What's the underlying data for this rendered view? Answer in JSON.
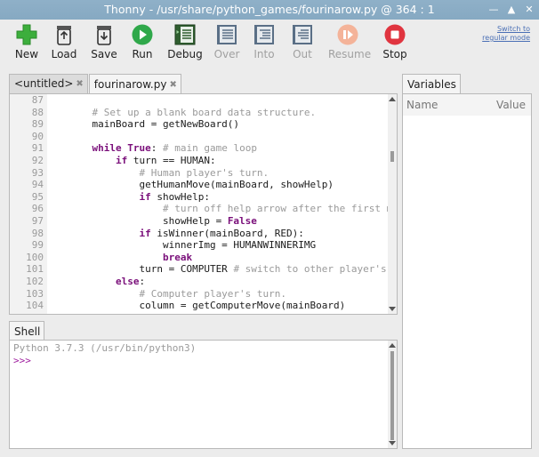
{
  "window": {
    "title": "Thonny  -  /usr/share/python_games/fourinarow.py  @  364 : 1"
  },
  "toolbar": {
    "new": "New",
    "load": "Load",
    "save": "Save",
    "run": "Run",
    "debug": "Debug",
    "over": "Over",
    "into": "Into",
    "out": "Out",
    "resume": "Resume",
    "stop": "Stop",
    "switch_mode_line1": "Switch to",
    "switch_mode_line2": "regular mode"
  },
  "editor": {
    "tabs": [
      {
        "label": "<untitled>"
      },
      {
        "label": "fourinarow.py"
      }
    ],
    "line_numbers": [
      "87",
      "88",
      "89",
      "90",
      "91",
      "92",
      "93",
      "94",
      "95",
      "96",
      "97",
      "98",
      "99",
      "100",
      "101",
      "102",
      "103",
      "104"
    ]
  },
  "shell": {
    "tab_label": "Shell",
    "banner": "Python 3.7.3 (/usr/bin/python3)",
    "prompt": ">>>"
  },
  "variables": {
    "tab_label": "Variables",
    "col_name": "Name",
    "col_value": "Value"
  },
  "colors": {
    "keyword": "#7a0f7a",
    "comment": "#9a9a9a",
    "titlebar": "#8aadc5"
  }
}
